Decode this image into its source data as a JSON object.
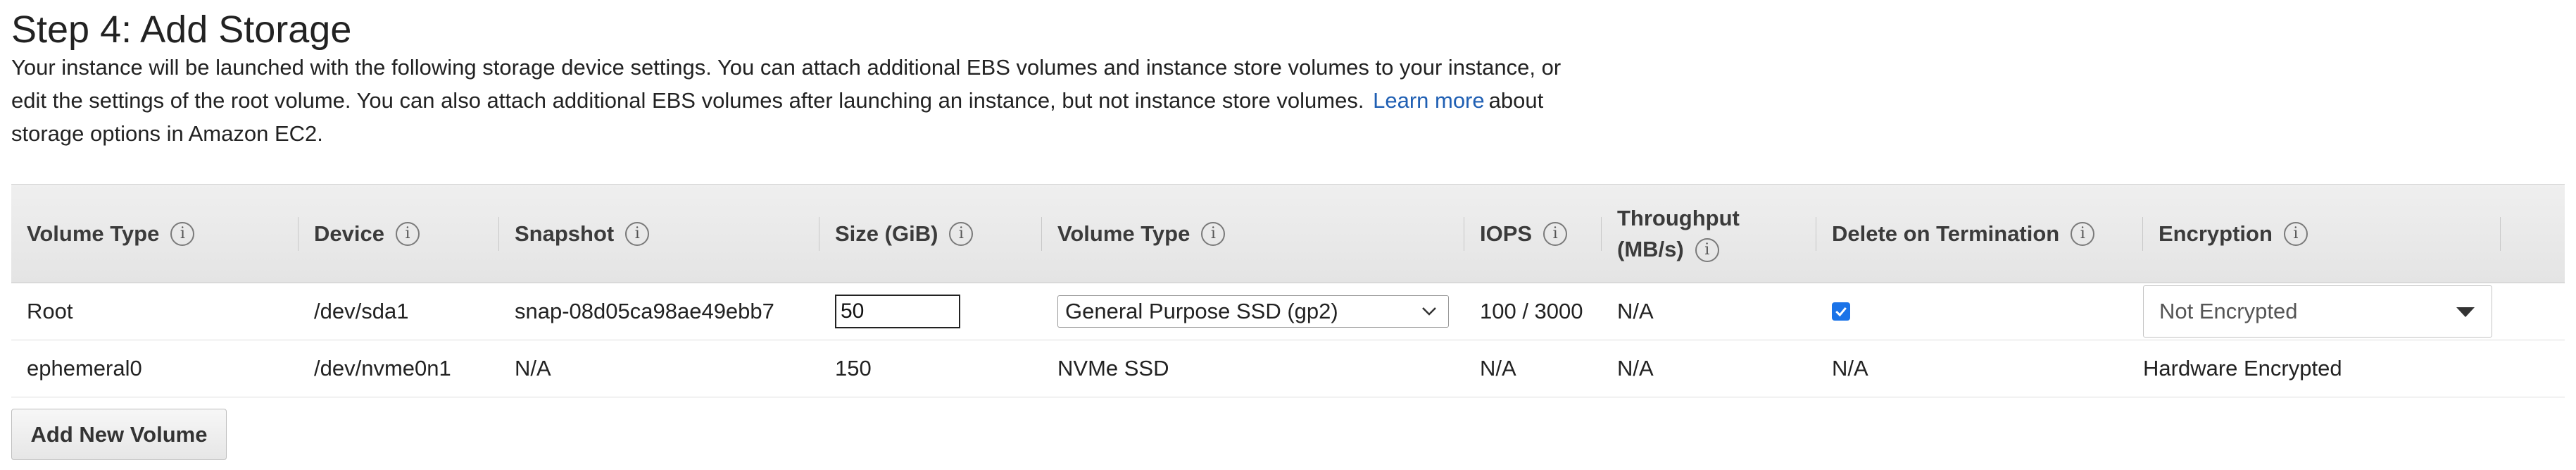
{
  "page": {
    "title": "Step 4: Add Storage",
    "description_line1": "Your instance will be launched with the following storage device settings. You can attach additional EBS volumes and instance store volumes to your instance, or",
    "description_line2": "edit the settings of the root volume. You can also attach additional EBS volumes after launching an instance, but not instance store volumes.",
    "learn_more": "Learn more",
    "description_after_link": "about",
    "description_line3": "storage options in Amazon EC2."
  },
  "table": {
    "headers": {
      "volume_type": "Volume Type",
      "device": "Device",
      "snapshot": "Snapshot",
      "size": "Size (GiB)",
      "volume_type2": "Volume Type",
      "iops": "IOPS",
      "throughput_line1": "Throughput",
      "throughput_line2": "(MB/s)",
      "delete_on_termination": "Delete on Termination",
      "encryption": "Encryption"
    },
    "info_glyph": "i",
    "rows": [
      {
        "volume_type": "Root",
        "device": "/dev/sda1",
        "snapshot": "snap-08d05ca98ae49ebb7",
        "size": "50",
        "ebs_volume_type": "General Purpose SSD (gp2)",
        "iops": "100 / 3000",
        "throughput": "N/A",
        "delete_on_termination": true,
        "encryption": "Not Encrypted"
      },
      {
        "volume_type": "ephemeral0",
        "device": "/dev/nvme0n1",
        "snapshot": "N/A",
        "size": "150",
        "ebs_volume_type": "NVMe SSD",
        "iops": "N/A",
        "throughput": "N/A",
        "delete_on_termination": "N/A",
        "encryption": "Hardware Encrypted"
      }
    ]
  },
  "actions": {
    "add_volume": "Add New Volume"
  },
  "colors": {
    "link": "#1f5fb3",
    "checkbox": "#1a73e8",
    "header_bg": "#e9e9e9"
  },
  "icons": {
    "info": "info-circle-icon",
    "select_chevron": "chevron-down-icon",
    "dropdown_caret": "caret-down-icon",
    "checkmark": "checkmark-icon"
  }
}
